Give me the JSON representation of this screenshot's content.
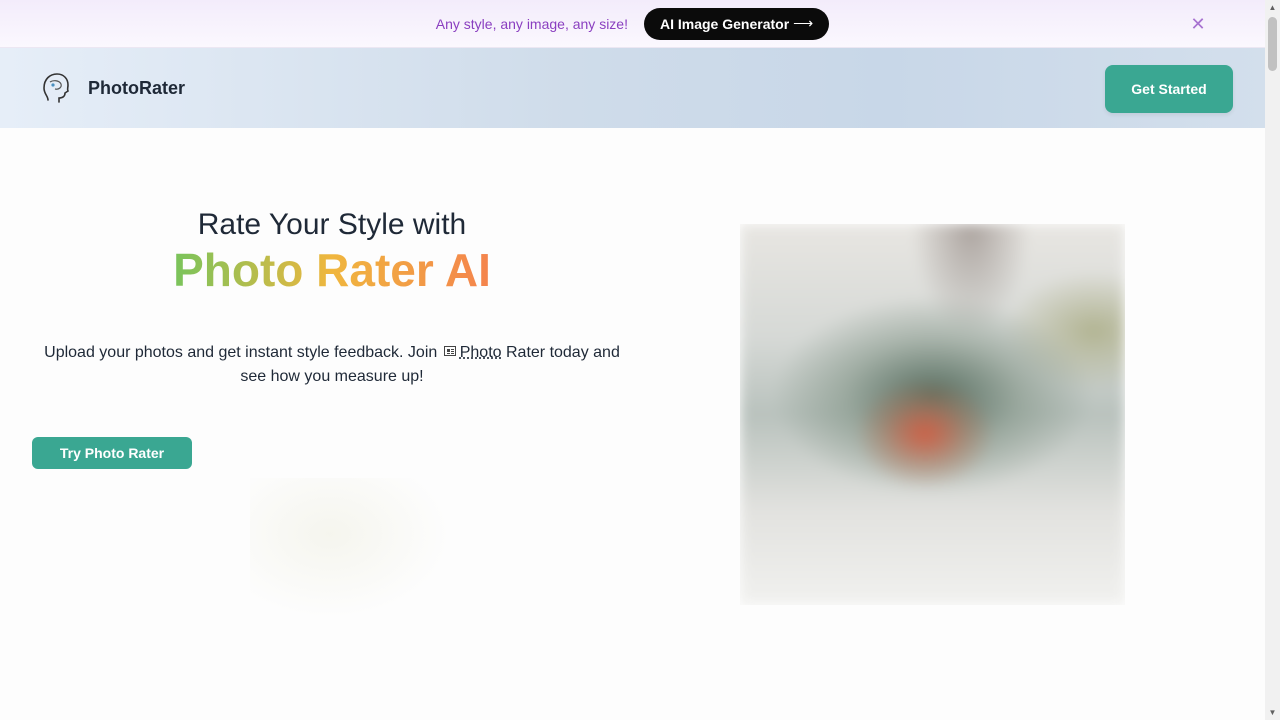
{
  "announcement": {
    "text": "Any style, any image, any size!",
    "cta_label": "AI Image Generator",
    "cta_arrow": "⟶",
    "close_glyph": "✕"
  },
  "header": {
    "brand": "PhotoRater",
    "logo_icon": "head-profile-icon",
    "cta_label": "Get Started"
  },
  "hero": {
    "title_line1": "Rate Your Style with",
    "title_line2": "Photo Rater AI",
    "desc_before": "Upload your photos and get instant style feedback. Join ",
    "desc_link": "Photo",
    "desc_after": " Rater today and see how you measure up!",
    "try_label": "Try Photo Rater",
    "image_alt": "hero-photo"
  },
  "colors": {
    "accent": "#3aa792",
    "announce_text": "#8a3fc0",
    "gradient": [
      "#22c27a",
      "#f0b63e",
      "#f15f6b"
    ]
  }
}
